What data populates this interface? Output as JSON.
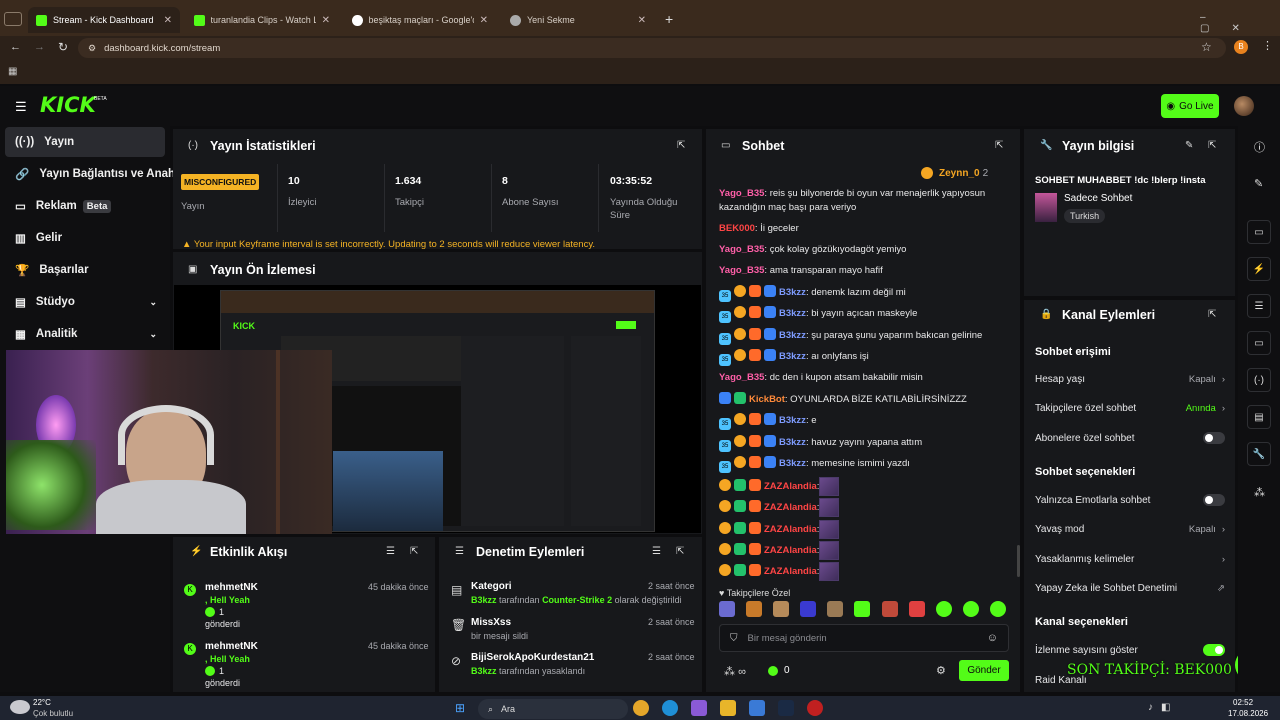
{
  "browser": {
    "tabs": [
      {
        "title": "Stream - Kick Dashboard",
        "active": true
      },
      {
        "title": "turanlandia Clips - Watch Live o",
        "active": false
      },
      {
        "title": "beşiktaş maçları - Google'da Ar",
        "active": false
      },
      {
        "title": "Yeni Sekme",
        "active": false
      }
    ],
    "url": "dashboard.kick.com/stream",
    "profile_initial": "B"
  },
  "header": {
    "logo": "KICK",
    "logo_badge": "BETA",
    "go_live": "Go Live"
  },
  "sidebar": {
    "items": [
      {
        "label": "Yayın",
        "active": true
      },
      {
        "label": "Yayın Bağlantısı ve Anahtarı"
      },
      {
        "label": "Reklam",
        "badge": "Beta"
      },
      {
        "label": "Gelir"
      },
      {
        "label": "Başarılar"
      },
      {
        "label": "Stüdyo",
        "chevron": "⌄"
      },
      {
        "label": "Analitik",
        "chevron": "⌄"
      }
    ]
  },
  "stats": {
    "title": "Yayın İstatistikleri",
    "status_badge": "MISCONFIGURED",
    "status_label": "Yayın",
    "cols": [
      {
        "value": "10",
        "label": "İzleyici"
      },
      {
        "value": "1.634",
        "label": "Takipçi"
      },
      {
        "value": "8",
        "label": "Abone Sayısı"
      },
      {
        "value": "03:35:52",
        "label": "Yayında Olduğu Süre"
      }
    ],
    "warning": "Your input Keyframe interval is set incorrectly. Updating to 2 seconds will reduce viewer latency."
  },
  "preview": {
    "title": "Yayın Ön İzlemesi"
  },
  "activity": {
    "title": "Etkinlik Akışı",
    "items": [
      {
        "user": "mehmetNK",
        "time": "45 dakika önce",
        "msg": ", Hell Yeah",
        "count": "1",
        "sent": "gönderdi"
      },
      {
        "user": "mehmetNK",
        "time": "45 dakika önce",
        "msg": ", Hell Yeah",
        "count": "1",
        "sent": "gönderdi"
      }
    ]
  },
  "moderation": {
    "title": "Denetim Eylemleri",
    "items": [
      {
        "title": "Kategori",
        "time": "2 saat önce",
        "actor": "B3kzz",
        "text1": " tarafından ",
        "target": "Counter-Strike 2",
        "text2": " olarak değiştirildi"
      },
      {
        "title": "MissXss",
        "time": "2 saat önce",
        "text1": "bir mesajı sildi"
      },
      {
        "title": "BijiSerokApoKurdestan21",
        "time": "2 saat önce",
        "actor": "B3kzz",
        "text1": " tarafından yasaklandı"
      }
    ]
  },
  "chat": {
    "title": "Sohbet",
    "pinned_user": "Zeynn_0",
    "pinned_count": "2",
    "messages": [
      {
        "user": "Yago_B35",
        "color": "pink",
        "text": ": reis şu bilyonerde bi oyun var menajerlik yapıyosun kazandığın maç başı para veriyo"
      },
      {
        "user": "BEK000",
        "color": "red",
        "text": ": İi geceler"
      },
      {
        "user": "Yago_B35",
        "color": "pink",
        "text": ": çok kolay gözükıyodagöt yemiyo"
      },
      {
        "user": "Yago_B35",
        "color": "pink",
        "text": ": ama transparan mayo hafif"
      },
      {
        "user": "B3kzz",
        "color": "purple",
        "badges": true,
        "text": ": denemk lazım değil mi"
      },
      {
        "user": "B3kzz",
        "color": "purple",
        "badges": true,
        "text": ": bi yayın açıcan maskeyle"
      },
      {
        "user": "B3kzz",
        "color": "purple",
        "badges": true,
        "text": ": şu paraya şunu yaparım bakıcan gelirine"
      },
      {
        "user": "B3kzz",
        "color": "purple",
        "badges": true,
        "text": ": aı onlyfans işi"
      },
      {
        "user": "Yago_B35",
        "color": "pink",
        "text": ": dc den i kupon atsam bakabilir misin"
      },
      {
        "user": "KickBot",
        "color": "orange",
        "bot": true,
        "text": ": OYUNLARDA BİZE KATILABİLİRSİNİZZZ"
      },
      {
        "user": "B3kzz",
        "color": "purple",
        "badges": true,
        "text": ": e"
      },
      {
        "user": "B3kzz",
        "color": "purple",
        "badges": true,
        "text": ": havuz yayını yapana attım"
      },
      {
        "user": "B3kzz",
        "color": "purple",
        "badges": true,
        "text": ": memesine ismimi yazdı"
      },
      {
        "user": "ZAZAlandia",
        "color": "red",
        "emote": true,
        "text": ":"
      },
      {
        "user": "ZAZAlandia",
        "color": "red",
        "emote": true,
        "text": ":"
      },
      {
        "user": "ZAZAlandia",
        "color": "red",
        "emote": true,
        "text": ":"
      },
      {
        "user": "ZAZAlandia",
        "color": "red",
        "emote": true,
        "text": ":"
      },
      {
        "user": "ZAZAlandia",
        "color": "red",
        "emote": true,
        "text": ":"
      }
    ],
    "followers_only": "Takipçilere Özel",
    "input_placeholder": "Bir mesaj gönderin",
    "infinity": "∞",
    "points": "0",
    "send": "Gönder"
  },
  "stream_info": {
    "title": "Yayın bilgisi",
    "stream_title": "SOHBET MUHABBET !dc !blerp !insta",
    "category": "Sadece Sohbet",
    "tag": "Turkish"
  },
  "channel_actions": {
    "title": "Kanal Eylemleri",
    "chat_access": "Sohbet erişimi",
    "rows_access": [
      {
        "label": "Hesap yaşı",
        "value": "Kapalı",
        "type": "chevron"
      },
      {
        "label": "Takipçilere özel sohbet",
        "value": "Anında",
        "type": "chevron",
        "green": true
      },
      {
        "label": "Abonelere özel sohbet",
        "type": "toggle"
      }
    ],
    "chat_options": "Sohbet seçenekleri",
    "rows_options": [
      {
        "label": "Yalnızca Emotlarla sohbet",
        "type": "toggle"
      },
      {
        "label": "Yavaş mod",
        "value": "Kapalı",
        "type": "chevron"
      },
      {
        "label": "Yasaklanmış kelimeler",
        "type": "chevron"
      },
      {
        "label": "Yapay Zeka ile Sohbet Denetimi",
        "type": "external"
      }
    ],
    "channel_options": "Kanal seçenekleri",
    "rows_channel": [
      {
        "label": "İzlenme sayısını göster",
        "type": "toggle-on"
      },
      {
        "label": "Raid Kanalı"
      }
    ]
  },
  "overlay_text": "SON TAKİPÇİ: BEK000",
  "taskbar": {
    "weather_temp": "22°C",
    "weather_desc": "Çok bulutlu",
    "search": "Ara",
    "time": "02:52",
    "date": "17.08.2026"
  }
}
